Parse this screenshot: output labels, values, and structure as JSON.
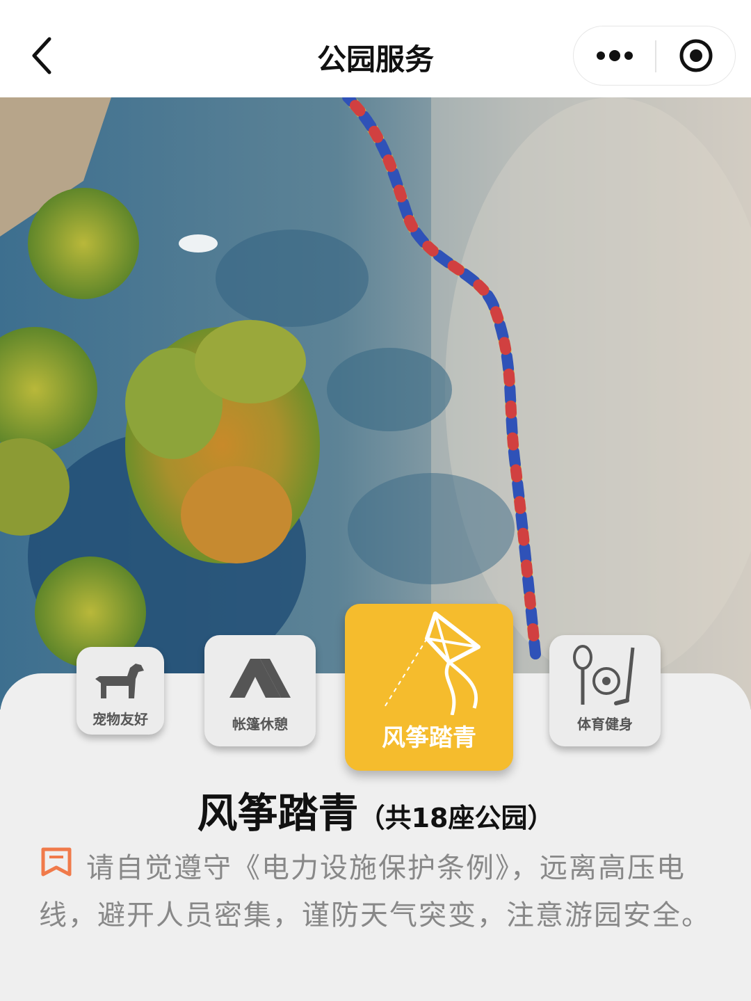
{
  "navbar": {
    "title": "公园服务",
    "back_icon": "chevron-left-icon",
    "more_icon": "more-dots-icon",
    "close_icon": "target-circle-icon"
  },
  "hero": {
    "image": "aerial view of lake with trees and colorful float line"
  },
  "categories": [
    {
      "label": "宠物友好",
      "icon": "dog-icon",
      "active": false
    },
    {
      "label": "帐篷休憩",
      "icon": "tent-icon",
      "active": false
    },
    {
      "label": "风筝踏青",
      "icon": "kite-icon",
      "active": true
    },
    {
      "label": "体育健身",
      "icon": "sports-icon",
      "active": false
    }
  ],
  "section": {
    "title": "风筝踏青",
    "count_text": "（共18座公园）"
  },
  "notice": {
    "icon": "bookmark-icon",
    "text": "请自觉遵守《电力设施保护条例》，远离高压电线，避开人员密集，谨防天气突变，注意游园安全。"
  },
  "colors": {
    "accent": "#f5bc2d",
    "notice_icon": "#f07a4a",
    "card_bg": "#efefef"
  }
}
